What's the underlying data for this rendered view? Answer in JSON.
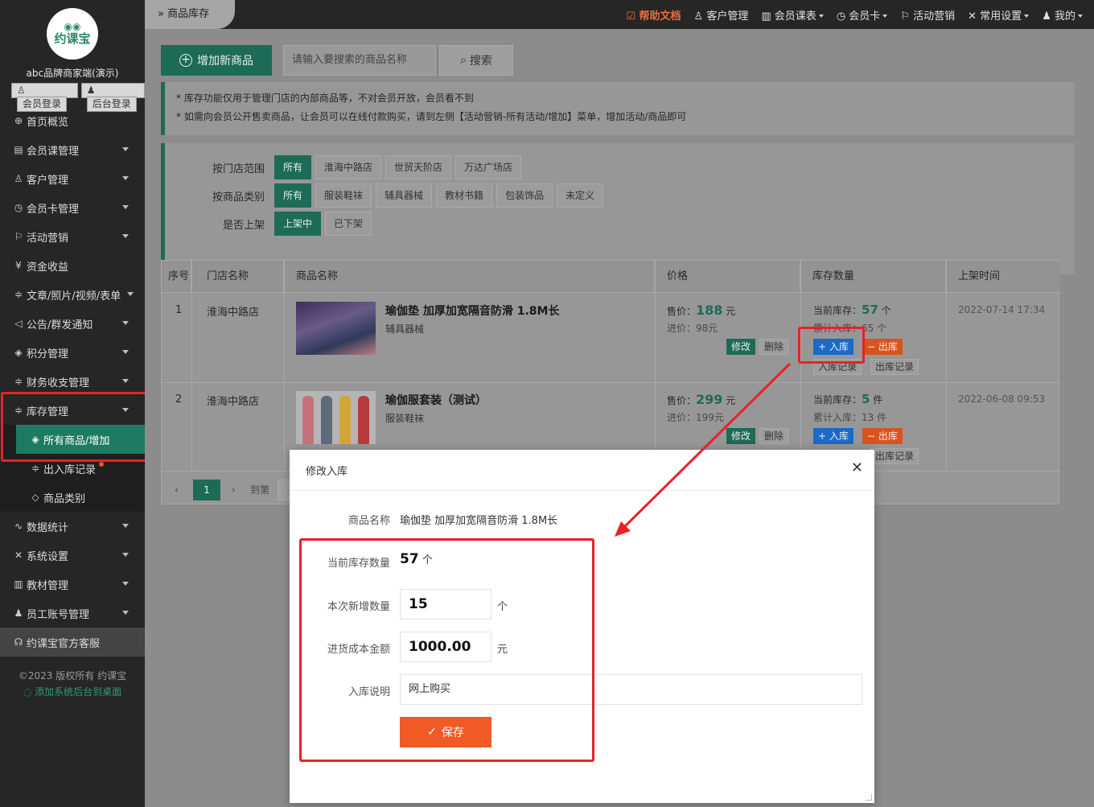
{
  "sidebar": {
    "logo_text": "约课宝",
    "merchant": "abc品牌商家端(演示)",
    "member_login": "会员登录",
    "admin_login": "后台登录",
    "items": [
      {
        "label": "首页概览",
        "icon": "globe-icon",
        "glyph": "⊕"
      },
      {
        "label": "会员课管理",
        "icon": "document-icon",
        "glyph": "▤"
      },
      {
        "label": "客户管理",
        "icon": "user-icon",
        "glyph": "♙"
      },
      {
        "label": "会员卡管理",
        "icon": "clock-icon",
        "glyph": "◷"
      },
      {
        "label": "活动营销",
        "icon": "flag-icon",
        "glyph": "⚐"
      },
      {
        "label": "资金收益",
        "icon": "yen-icon",
        "glyph": "¥"
      },
      {
        "label": "文章/照片/视频/表单",
        "icon": "sliders-icon",
        "glyph": "≑"
      },
      {
        "label": "公告/群发通知",
        "icon": "megaphone-icon",
        "glyph": "◁"
      },
      {
        "label": "积分管理",
        "icon": "diamond-icon",
        "glyph": "◈"
      },
      {
        "label": "财务收支管理",
        "icon": "sliders-icon",
        "glyph": "≑"
      },
      {
        "label": "库存管理",
        "icon": "sliders-icon",
        "glyph": "≑"
      }
    ],
    "sub_items": [
      {
        "label": "所有商品/增加",
        "icon": "layers-icon",
        "glyph": "◈"
      },
      {
        "label": "出入库记录",
        "icon": "sliders-icon",
        "glyph": "≑"
      },
      {
        "label": "商品类别",
        "icon": "tag-icon",
        "glyph": "◇"
      }
    ],
    "items2": [
      {
        "label": "数据统计",
        "icon": "pulse-icon",
        "glyph": "∿"
      },
      {
        "label": "系统设置",
        "icon": "tools-icon",
        "glyph": "✕"
      },
      {
        "label": "教材管理",
        "icon": "book-icon",
        "glyph": "▥"
      },
      {
        "label": "员工账号管理",
        "icon": "person-icon",
        "glyph": "♟"
      }
    ],
    "service": "约课宝官方客服",
    "copyright": "©2023 版权所有 约课宝",
    "add_desktop": "添加系统后台到桌面"
  },
  "topbar": {
    "current_tab": "商品库存",
    "help": "帮助文档",
    "customers": "客户管理",
    "schedule": "会员课表",
    "card": "会员卡",
    "marketing": "活动营销",
    "settings": "常用设置",
    "me": "我的"
  },
  "toolbar": {
    "add_label": "增加新商品",
    "search_placeholder": "请输入要搜索的商品名称",
    "search_label": "搜索"
  },
  "notice": {
    "line1": "* 库存功能仅用于管理门店的内部商品等，不对会员开放，会员看不到",
    "line2": "* 如需向会员公开售卖商品，让会员可以在线付款购买，请到左侧【活动营销-所有活动/增加】菜单，增加活动/商品即可"
  },
  "filters": {
    "store_label": "按门店范围",
    "stores": [
      "所有",
      "淮海中路店",
      "世贸天阶店",
      "万达广场店"
    ],
    "category_label": "按商品类别",
    "categories": [
      "所有",
      "服装鞋袜",
      "辅具器械",
      "教材书籍",
      "包装饰品",
      "未定义"
    ],
    "status_label": "是否上架",
    "statuses": [
      "上架中",
      "已下架"
    ]
  },
  "table": {
    "headers": [
      "序号",
      "门店名称",
      "商品名称",
      "价格",
      "库存数量",
      "上架时间"
    ],
    "rows": [
      {
        "no": "1",
        "store": "淮海中路店",
        "name": "瑜伽垫 加厚加宽隔音防滑 1.8M长",
        "category": "辅具器械",
        "price_label": "售价：",
        "price": "188",
        "price_unit": "元",
        "cost": "进价：98元",
        "stock_label": "当前库存：",
        "stock": "57",
        "stock_unit": "个",
        "total_in": "累计入库：65 个",
        "date": "2022-07-14 17:34"
      },
      {
        "no": "2",
        "store": "淮海中路店",
        "name": "瑜伽服套装（测试）",
        "category": "服装鞋袜",
        "price_label": "售价：",
        "price": "299",
        "price_unit": "元",
        "cost": "进价：199元",
        "stock_label": "当前库存：",
        "stock": "5",
        "stock_unit": "件",
        "total_in": "累计入库：13 件",
        "date": "2022-06-08 09:53"
      }
    ],
    "edit": "修改",
    "delete": "删除",
    "stock_in": "入库",
    "stock_out": "出库",
    "in_record": "入库记录",
    "out_record": "出库记录"
  },
  "pager": {
    "current": "1",
    "goto": "到第"
  },
  "modal": {
    "title": "修改入库",
    "name_label": "商品名称",
    "name_value": "瑜伽垫 加厚加宽隔音防滑 1.8M长",
    "current_label": "当前库存数量",
    "current_value": "57",
    "current_unit": "个",
    "add_label": "本次新增数量",
    "add_value": "15",
    "add_unit": "个",
    "cost_label": "进货成本金额",
    "cost_value": "1000.00",
    "cost_unit": "元",
    "note_label": "入库说明",
    "note_value": "网上购买",
    "save_label": "保存"
  },
  "colors": {
    "accent": "#1d6b56",
    "annotation": "#e8212a",
    "save": "#f05a24",
    "stock_in": "#1a6ac7",
    "stock_out": "#d8541e"
  }
}
